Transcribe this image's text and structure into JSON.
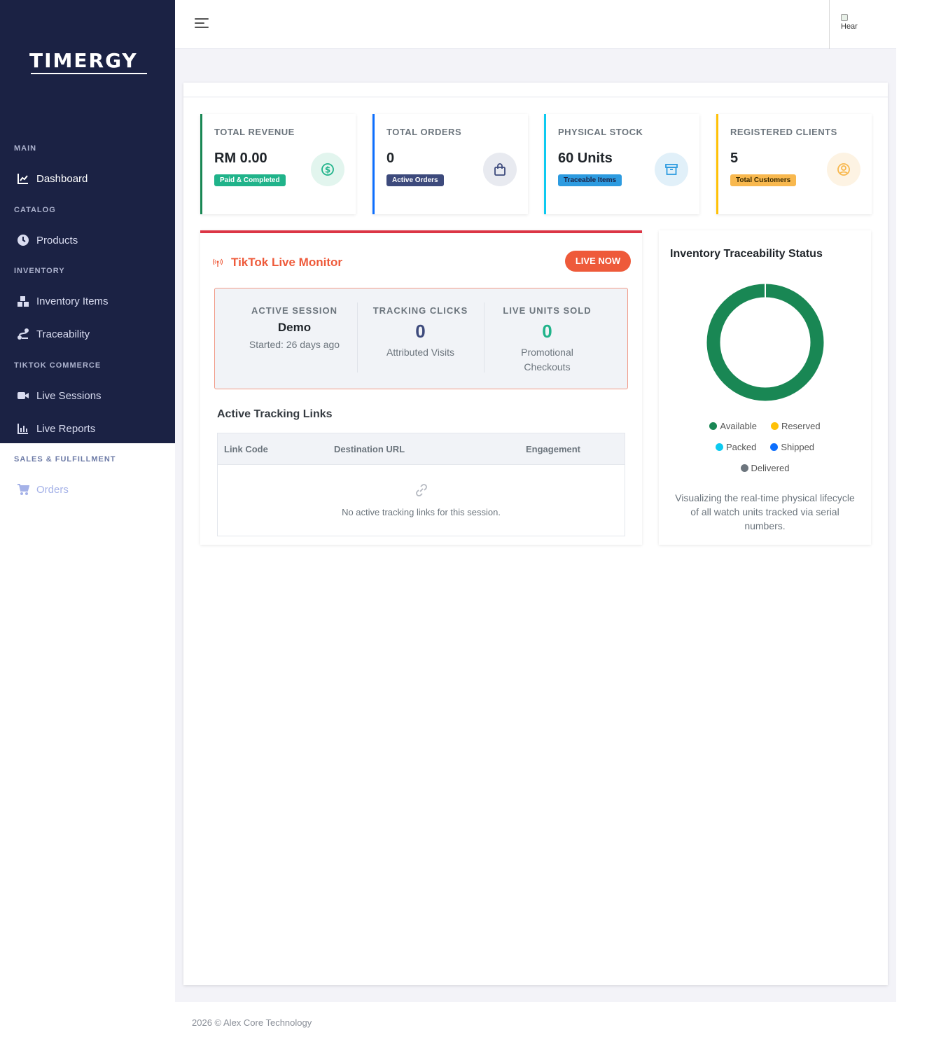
{
  "brand": {
    "name": "TIMERGY"
  },
  "sidebar": {
    "sections": [
      {
        "label": "MAIN"
      },
      {
        "label": "CATALOG"
      },
      {
        "label": "INVENTORY"
      },
      {
        "label": "TIKTOK COMMERCE"
      },
      {
        "label": "SALES & FULFILLMENT"
      }
    ],
    "items": [
      {
        "label": "Dashboard",
        "icon": "chart-line-icon"
      },
      {
        "label": "Products",
        "icon": "clock-icon"
      },
      {
        "label": "Inventory Items",
        "icon": "boxes-icon"
      },
      {
        "label": "Traceability",
        "icon": "route-icon"
      },
      {
        "label": "Live Sessions",
        "icon": "video-camera-icon"
      },
      {
        "label": "Live Reports",
        "icon": "bar-chart-icon"
      },
      {
        "label": "Orders",
        "icon": "cart-icon"
      }
    ]
  },
  "topbar": {
    "avatar_alt": "Hear"
  },
  "stats": [
    {
      "label": "TOTAL REVENUE",
      "value": "RM 0.00",
      "badge": "Paid & Completed",
      "icon": "dollar-icon",
      "accent": "#198754"
    },
    {
      "label": "TOTAL ORDERS",
      "value": "0",
      "badge": "Active Orders",
      "icon": "shopping-bag-icon",
      "accent": "#0d6efd"
    },
    {
      "label": "PHYSICAL STOCK",
      "value": "60 Units",
      "badge": "Traceable Items",
      "icon": "archive-icon",
      "accent": "#0dcaf0"
    },
    {
      "label": "REGISTERED CLIENTS",
      "value": "5",
      "badge": "Total Customers",
      "icon": "user-circle-icon",
      "accent": "#ffc107"
    }
  ],
  "live_monitor": {
    "title": "TikTok Live Monitor",
    "status_button": "LIVE NOW",
    "session": {
      "label": "ACTIVE SESSION",
      "name": "Demo",
      "started": "Started: 26 days ago"
    },
    "clicks": {
      "label": "TRACKING CLICKS",
      "value": "0",
      "sub": "Attributed Visits"
    },
    "units": {
      "label": "LIVE UNITS SOLD",
      "value": "0",
      "sub": "Promotional Checkouts"
    },
    "links": {
      "title": "Active Tracking Links",
      "columns": [
        "Link Code",
        "Destination URL",
        "Engagement"
      ],
      "empty_text": "No active tracking links for this session."
    }
  },
  "traceability": {
    "title": "Inventory Traceability Status",
    "legend": [
      {
        "label": "Available",
        "color": "#198754"
      },
      {
        "label": "Reserved",
        "color": "#ffc107"
      },
      {
        "label": "Packed",
        "color": "#0dcaf0"
      },
      {
        "label": "Shipped",
        "color": "#0d6efd"
      },
      {
        "label": "Delivered",
        "color": "#6c757d"
      }
    ],
    "values": [
      60,
      0,
      0,
      0,
      0
    ],
    "description": "Visualizing the real-time physical lifecycle of all watch units tracked via serial numbers."
  },
  "footer": {
    "text": "2026 © Alex Core Technology"
  }
}
